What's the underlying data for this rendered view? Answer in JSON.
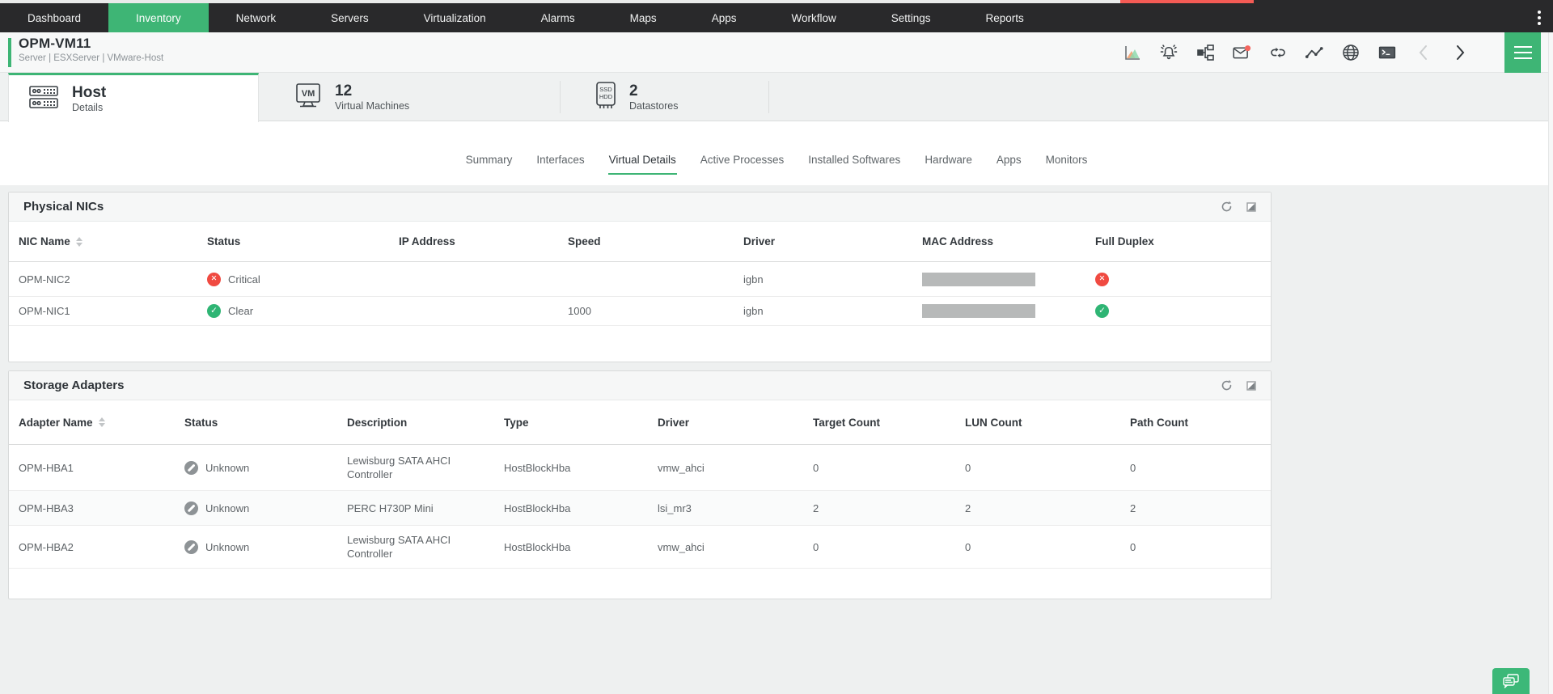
{
  "colors": {
    "accent_green": "#3eb575",
    "nav_bg": "#29292b",
    "critical_red": "#f04a41",
    "clear_green": "#2fb574",
    "unknown_gray": "#8e9396",
    "top_strip_red": "#f45b55"
  },
  "nav": {
    "items": [
      {
        "label": "Dashboard",
        "active": false
      },
      {
        "label": "Inventory",
        "active": true
      },
      {
        "label": "Network",
        "active": false
      },
      {
        "label": "Servers",
        "active": false
      },
      {
        "label": "Virtualization",
        "active": false
      },
      {
        "label": "Alarms",
        "active": false
      },
      {
        "label": "Maps",
        "active": false
      },
      {
        "label": "Apps",
        "active": false
      },
      {
        "label": "Workflow",
        "active": false
      },
      {
        "label": "Settings",
        "active": false
      },
      {
        "label": "Reports",
        "active": false
      }
    ],
    "overflow_menu_icon": "kebab-menu"
  },
  "device": {
    "name": "OPM-VM11",
    "breadcrumb": "Server | ESXServer | VMware-Host",
    "header_icons": [
      "performance-chart-icon",
      "alarm-bell-icon",
      "workflow-topology-icon",
      "mail-notification-icon",
      "sync-loop-icon",
      "line-graph-icon",
      "globe-icon",
      "terminal-icon",
      "chevron-left-icon",
      "chevron-right-icon",
      "hamburger-menu-icon"
    ]
  },
  "entity_tabs": [
    {
      "value": "Host",
      "label": "Details",
      "icon": "host-server-icon",
      "active": true
    },
    {
      "value": "12",
      "label": "Virtual Machines",
      "icon": "vm-icon",
      "active": false
    },
    {
      "value": "2",
      "label": "Datastores",
      "icon": "ssd-hdd-icon",
      "active": false
    }
  ],
  "sub_tabs": [
    {
      "label": "Summary",
      "active": false
    },
    {
      "label": "Interfaces",
      "active": false
    },
    {
      "label": "Virtual Details",
      "active": true
    },
    {
      "label": "Active Processes",
      "active": false
    },
    {
      "label": "Installed Softwares",
      "active": false
    },
    {
      "label": "Hardware",
      "active": false
    },
    {
      "label": "Apps",
      "active": false
    },
    {
      "label": "Monitors",
      "active": false
    }
  ],
  "nic_section": {
    "title": "Physical NICs",
    "actions": [
      "refresh-icon",
      "resize-corner-icon"
    ],
    "columns": [
      "NIC Name",
      "Status",
      "IP Address",
      "Speed",
      "Driver",
      "MAC Address",
      "Full Duplex"
    ],
    "sorted_column": "NIC Name",
    "rows": [
      {
        "name": "OPM-NIC2",
        "status_label": "Critical",
        "severity": "critical",
        "ip": "",
        "speed": "",
        "driver": "igbn",
        "mac_display": "redacted",
        "full_duplex": "critical"
      },
      {
        "name": "OPM-NIC1",
        "status_label": "Clear",
        "severity": "clear",
        "ip": "",
        "speed": "1000",
        "driver": "igbn",
        "mac_display": "redacted",
        "full_duplex": "clear"
      }
    ]
  },
  "storage_section": {
    "title": "Storage Adapters",
    "actions": [
      "refresh-icon",
      "resize-corner-icon"
    ],
    "columns": [
      "Adapter Name",
      "Status",
      "Description",
      "Type",
      "Driver",
      "Target Count",
      "LUN Count",
      "Path Count"
    ],
    "sorted_column": "Adapter Name",
    "rows": [
      {
        "name": "OPM-HBA1",
        "status_label": "Unknown",
        "severity": "unknown",
        "description": "Lewisburg SATA AHCI Controller",
        "type": "HostBlockHba",
        "driver": "vmw_ahci",
        "target_count": "0",
        "lun_count": "0",
        "path_count": "0"
      },
      {
        "name": "OPM-HBA3",
        "status_label": "Unknown",
        "severity": "unknown",
        "description": "PERC H730P Mini",
        "type": "HostBlockHba",
        "driver": "lsi_mr3",
        "target_count": "2",
        "lun_count": "2",
        "path_count": "2"
      },
      {
        "name": "OPM-HBA2",
        "status_label": "Unknown",
        "severity": "unknown",
        "description": "Lewisburg SATA AHCI Controller",
        "type": "HostBlockHba",
        "driver": "vmw_ahci",
        "target_count": "0",
        "lun_count": "0",
        "path_count": "0"
      }
    ]
  }
}
